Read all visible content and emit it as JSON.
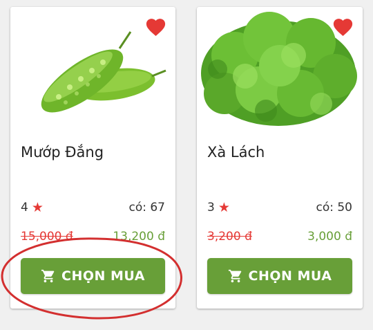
{
  "products": [
    {
      "name": "Mướp Đắng",
      "rating": "4",
      "stock": "có: 67",
      "old_price": "15,000 đ",
      "new_price": "13,200 đ",
      "buy_label": "CHỌN MUA",
      "image": "bitter-melon",
      "favorite_icon": "heart-icon"
    },
    {
      "name": "Xà Lách",
      "rating": "3",
      "stock": "có: 50",
      "old_price": "3,200 đ",
      "new_price": "3,000 đ",
      "buy_label": "CHỌN MUA",
      "image": "lettuce",
      "favorite_icon": "heart-icon"
    }
  ],
  "colors": {
    "accent_green": "#689f38",
    "heart_red": "#e53935",
    "annotation_red": "#d32f2f"
  }
}
